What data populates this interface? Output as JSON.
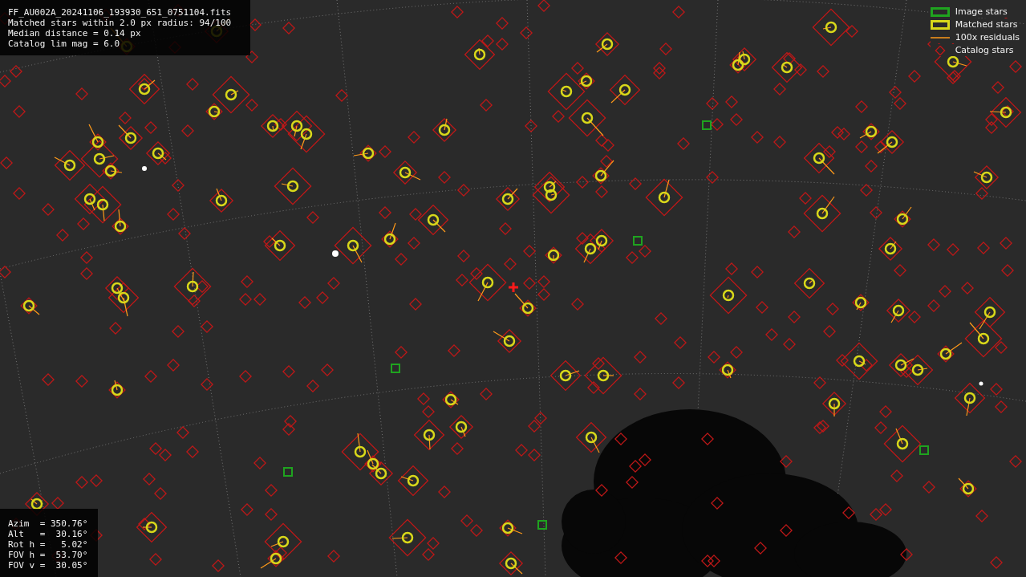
{
  "info_panel": {
    "lines": [
      "FF_AU002A_20241106_193930_651_0751104.fits",
      "Matched stars within 2.0 px radius: 94/100",
      "Median distance = 0.14 px",
      "Catalog lim mag = 6.0"
    ]
  },
  "pointing_panel": {
    "lines": [
      "Azim  = 350.76°",
      "Alt   =  30.16°",
      "Rot h =   5.02°",
      "FOV h =  53.70°",
      "FOV v =  30.05°"
    ]
  },
  "legend": [
    {
      "kind": "image",
      "label": "Image stars"
    },
    {
      "kind": "matched",
      "label": "Matched stars"
    },
    {
      "kind": "residual",
      "label": "100x residuals"
    },
    {
      "kind": "catalog",
      "label": "Catalog stars"
    }
  ]
}
